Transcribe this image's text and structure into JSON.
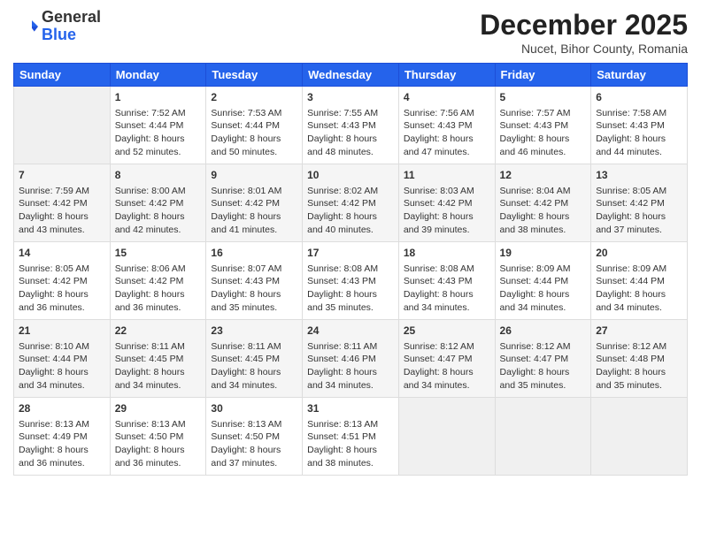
{
  "header": {
    "logo_general": "General",
    "logo_blue": "Blue",
    "title": "December 2025",
    "subtitle": "Nucet, Bihor County, Romania"
  },
  "days_of_week": [
    "Sunday",
    "Monday",
    "Tuesday",
    "Wednesday",
    "Thursday",
    "Friday",
    "Saturday"
  ],
  "weeks": [
    [
      {
        "day": "",
        "content": ""
      },
      {
        "day": "1",
        "content": "Sunrise: 7:52 AM\nSunset: 4:44 PM\nDaylight: 8 hours\nand 52 minutes."
      },
      {
        "day": "2",
        "content": "Sunrise: 7:53 AM\nSunset: 4:44 PM\nDaylight: 8 hours\nand 50 minutes."
      },
      {
        "day": "3",
        "content": "Sunrise: 7:55 AM\nSunset: 4:43 PM\nDaylight: 8 hours\nand 48 minutes."
      },
      {
        "day": "4",
        "content": "Sunrise: 7:56 AM\nSunset: 4:43 PM\nDaylight: 8 hours\nand 47 minutes."
      },
      {
        "day": "5",
        "content": "Sunrise: 7:57 AM\nSunset: 4:43 PM\nDaylight: 8 hours\nand 46 minutes."
      },
      {
        "day": "6",
        "content": "Sunrise: 7:58 AM\nSunset: 4:43 PM\nDaylight: 8 hours\nand 44 minutes."
      }
    ],
    [
      {
        "day": "7",
        "content": "Sunrise: 7:59 AM\nSunset: 4:42 PM\nDaylight: 8 hours\nand 43 minutes."
      },
      {
        "day": "8",
        "content": "Sunrise: 8:00 AM\nSunset: 4:42 PM\nDaylight: 8 hours\nand 42 minutes."
      },
      {
        "day": "9",
        "content": "Sunrise: 8:01 AM\nSunset: 4:42 PM\nDaylight: 8 hours\nand 41 minutes."
      },
      {
        "day": "10",
        "content": "Sunrise: 8:02 AM\nSunset: 4:42 PM\nDaylight: 8 hours\nand 40 minutes."
      },
      {
        "day": "11",
        "content": "Sunrise: 8:03 AM\nSunset: 4:42 PM\nDaylight: 8 hours\nand 39 minutes."
      },
      {
        "day": "12",
        "content": "Sunrise: 8:04 AM\nSunset: 4:42 PM\nDaylight: 8 hours\nand 38 minutes."
      },
      {
        "day": "13",
        "content": "Sunrise: 8:05 AM\nSunset: 4:42 PM\nDaylight: 8 hours\nand 37 minutes."
      }
    ],
    [
      {
        "day": "14",
        "content": "Sunrise: 8:05 AM\nSunset: 4:42 PM\nDaylight: 8 hours\nand 36 minutes."
      },
      {
        "day": "15",
        "content": "Sunrise: 8:06 AM\nSunset: 4:42 PM\nDaylight: 8 hours\nand 36 minutes."
      },
      {
        "day": "16",
        "content": "Sunrise: 8:07 AM\nSunset: 4:43 PM\nDaylight: 8 hours\nand 35 minutes."
      },
      {
        "day": "17",
        "content": "Sunrise: 8:08 AM\nSunset: 4:43 PM\nDaylight: 8 hours\nand 35 minutes."
      },
      {
        "day": "18",
        "content": "Sunrise: 8:08 AM\nSunset: 4:43 PM\nDaylight: 8 hours\nand 34 minutes."
      },
      {
        "day": "19",
        "content": "Sunrise: 8:09 AM\nSunset: 4:44 PM\nDaylight: 8 hours\nand 34 minutes."
      },
      {
        "day": "20",
        "content": "Sunrise: 8:09 AM\nSunset: 4:44 PM\nDaylight: 8 hours\nand 34 minutes."
      }
    ],
    [
      {
        "day": "21",
        "content": "Sunrise: 8:10 AM\nSunset: 4:44 PM\nDaylight: 8 hours\nand 34 minutes."
      },
      {
        "day": "22",
        "content": "Sunrise: 8:11 AM\nSunset: 4:45 PM\nDaylight: 8 hours\nand 34 minutes."
      },
      {
        "day": "23",
        "content": "Sunrise: 8:11 AM\nSunset: 4:45 PM\nDaylight: 8 hours\nand 34 minutes."
      },
      {
        "day": "24",
        "content": "Sunrise: 8:11 AM\nSunset: 4:46 PM\nDaylight: 8 hours\nand 34 minutes."
      },
      {
        "day": "25",
        "content": "Sunrise: 8:12 AM\nSunset: 4:47 PM\nDaylight: 8 hours\nand 34 minutes."
      },
      {
        "day": "26",
        "content": "Sunrise: 8:12 AM\nSunset: 4:47 PM\nDaylight: 8 hours\nand 35 minutes."
      },
      {
        "day": "27",
        "content": "Sunrise: 8:12 AM\nSunset: 4:48 PM\nDaylight: 8 hours\nand 35 minutes."
      }
    ],
    [
      {
        "day": "28",
        "content": "Sunrise: 8:13 AM\nSunset: 4:49 PM\nDaylight: 8 hours\nand 36 minutes."
      },
      {
        "day": "29",
        "content": "Sunrise: 8:13 AM\nSunset: 4:50 PM\nDaylight: 8 hours\nand 36 minutes."
      },
      {
        "day": "30",
        "content": "Sunrise: 8:13 AM\nSunset: 4:50 PM\nDaylight: 8 hours\nand 37 minutes."
      },
      {
        "day": "31",
        "content": "Sunrise: 8:13 AM\nSunset: 4:51 PM\nDaylight: 8 hours\nand 38 minutes."
      },
      {
        "day": "",
        "content": ""
      },
      {
        "day": "",
        "content": ""
      },
      {
        "day": "",
        "content": ""
      }
    ]
  ]
}
